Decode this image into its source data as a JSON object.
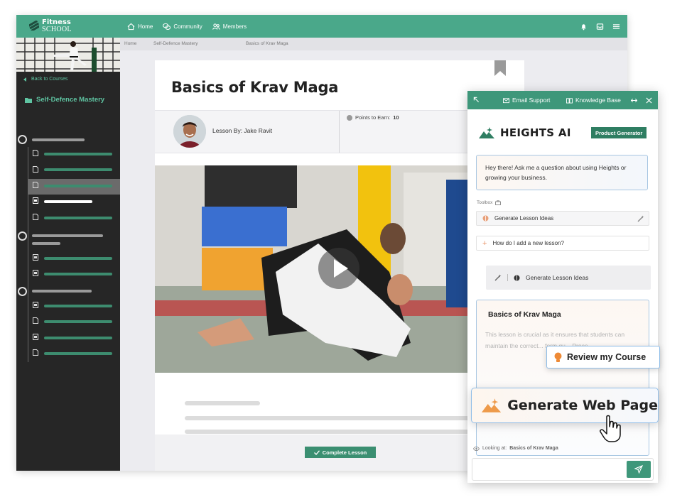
{
  "topbar": {
    "logo_line1": "Fitness",
    "logo_line2": "SCHOOL",
    "nav": [
      {
        "label": "Home",
        "icon": "home-icon"
      },
      {
        "label": "Community",
        "icon": "chat-bubbles-icon"
      },
      {
        "label": "Members",
        "icon": "users-icon"
      }
    ],
    "icons": [
      "bell-icon",
      "inbox-icon",
      "hamburger-menu-icon"
    ]
  },
  "sidebar": {
    "back_label": "Back to Courses",
    "course_title": "Self-Defence Mastery"
  },
  "breadcrumb": {
    "home": "Home",
    "course": "Self-Defence Mastery",
    "lesson": "Basics of Krav Maga"
  },
  "lesson": {
    "title": "Basics of Krav Maga",
    "lesson_by": "Lesson By: Jake Ravit",
    "points_label": "Points to Earn:",
    "points_value": "10",
    "complete_button": "Complete Lesson"
  },
  "ai_panel": {
    "header": {
      "email_support": "Email Support",
      "knowledge_base": "Knowledge Base"
    },
    "brand": "HEIGHTS AI",
    "badge": "Product Generator",
    "greeting": "Hey there! Ask me a question about using Heights or growing your business.",
    "toolbox_label": "Toolbox",
    "toolbox_items": [
      "Generate Lesson Ideas",
      "How do I add a new lesson?"
    ],
    "generate_button": "Generate Lesson Ideas",
    "content_title": "Basics of Krav Maga",
    "content_text": "This lesson is crucial as it ensures that students can maintain the correct... form gu... Proce...",
    "looking_at_label": "Looking at:",
    "looking_at_value": "Basics of Krav Maga",
    "input_placeholder": ""
  },
  "floating": {
    "review": "Review my Course",
    "generate_web_page": "Generate Web Page"
  },
  "colors": {
    "brand_green": "#4aa88a",
    "dark_green": "#2f7e62",
    "sidebar_bg": "#262626",
    "accent_blue_border": "#8fbde8"
  }
}
